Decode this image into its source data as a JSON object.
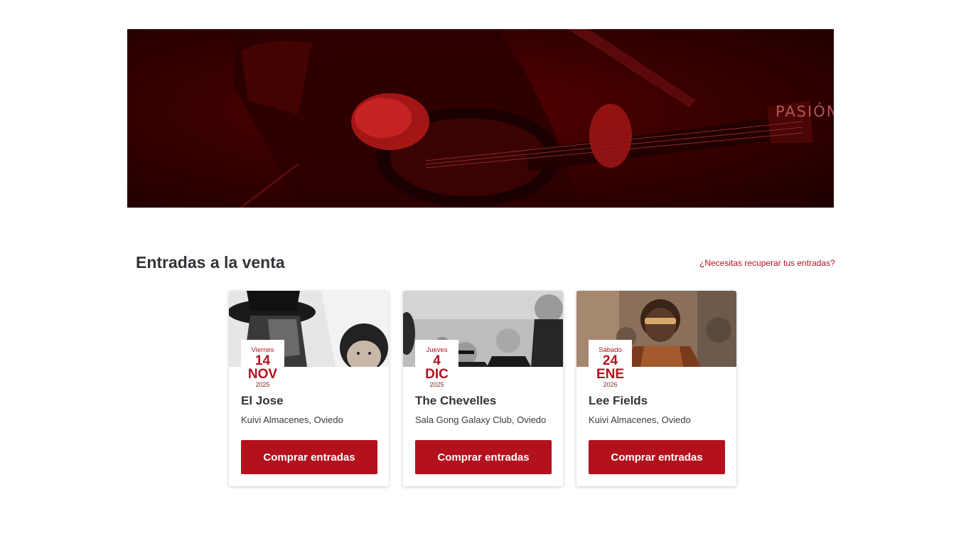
{
  "hero": {
    "text": "PASIÓN"
  },
  "section": {
    "title": "Entradas a la venta",
    "recover_link": "¿Necesitas recuperar tus entradas?"
  },
  "events": [
    {
      "weekday": "Viernes",
      "day": "14",
      "month": "NOV",
      "year": "2025",
      "artist": "El Jose",
      "venue": "Kuivi Almacenes, Oviedo",
      "button": "Comprar entradas"
    },
    {
      "weekday": "Jueves",
      "day": "4",
      "month": "DIC",
      "year": "2025",
      "artist": "The Chevelles",
      "venue": "Sala Gong Galaxy Club, Oviedo",
      "button": "Comprar entradas"
    },
    {
      "weekday": "Sábado",
      "day": "24",
      "month": "ENE",
      "year": "2026",
      "artist": "Lee Fields",
      "venue": "Kuivi Almacenes, Oviedo",
      "button": "Comprar entradas"
    }
  ],
  "colors": {
    "accent": "#b3121d",
    "hero_dark": "#2a0000",
    "text": "#33333b"
  }
}
